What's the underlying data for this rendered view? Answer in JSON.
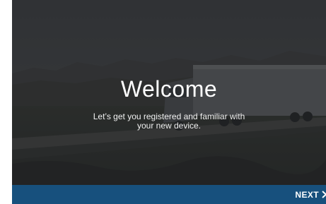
{
  "welcome": {
    "title": "Welcome",
    "subtitle": "Let’s get you registered and familiar with your new device."
  },
  "footer": {
    "next_label": "NEXT",
    "next_icon": "chevron-right-icon"
  },
  "colors": {
    "bottom_bar": "#17507d",
    "text": "#ffffff"
  }
}
